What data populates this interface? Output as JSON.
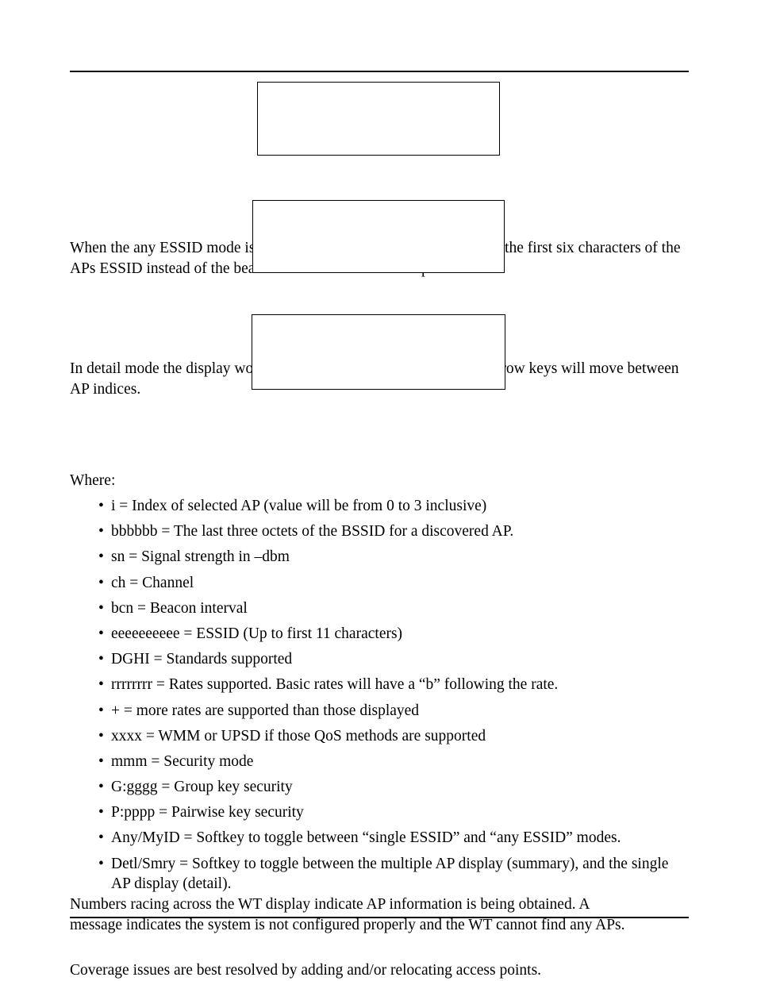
{
  "page": {
    "header_rule": "horizontal-rule",
    "footer_rule": "horizontal-rule"
  },
  "figures": [
    {
      "name": "summary-display-figure-1",
      "caption": ""
    },
    {
      "name": "any-essid-summary-display-figure-2",
      "caption": ""
    },
    {
      "name": "detail-mode-display-figure-3",
      "caption": ""
    }
  ],
  "body": {
    "paragraph_1": "When the any ESSID mode is selected, the summary display contains the first six characters of the APs ESSID instead of the beacon interval as in the example below.",
    "paragraph_2": "In detail mode the display would appear as follows. The Left/Right arrow keys will move between AP indices.",
    "where_label": "Where:",
    "paragraph_numbers_part1": "Numbers racing across the WT display indicate AP information is being obtained. A",
    "paragraph_numbers_part2": "message indicates the system is not configured properly and the WT cannot find any APs.",
    "paragraph_coverage": "Coverage issues are best resolved by adding and/or relocating access points."
  },
  "legend": {
    "bullet_glyph": "•",
    "items": [
      "i = Index of selected AP (value will be from 0 to 3 inclusive)",
      "bbbbbb = The last three octets of the BSSID for a discovered AP.",
      "sn = Signal strength in –dbm",
      "ch = Channel",
      "bcn = Beacon interval",
      "eeeeeeeeee = ESSID (Up to first 11 characters)",
      "DGHI = Standards supported",
      "rrrrrrrr = Rates supported. Basic rates will have a “b” following the rate.",
      "+ = more rates are supported than those displayed",
      "xxxx = WMM or UPSD if those QoS methods are supported",
      "mmm = Security mode",
      "G:gggg = Group key security",
      "P:pppp = Pairwise key security",
      "Any/MyID = Softkey to toggle between “single ESSID” and “any ESSID” modes.",
      "Detl/Smry = Softkey to toggle between the multiple AP display (summary), and the single AP display (detail)."
    ]
  }
}
